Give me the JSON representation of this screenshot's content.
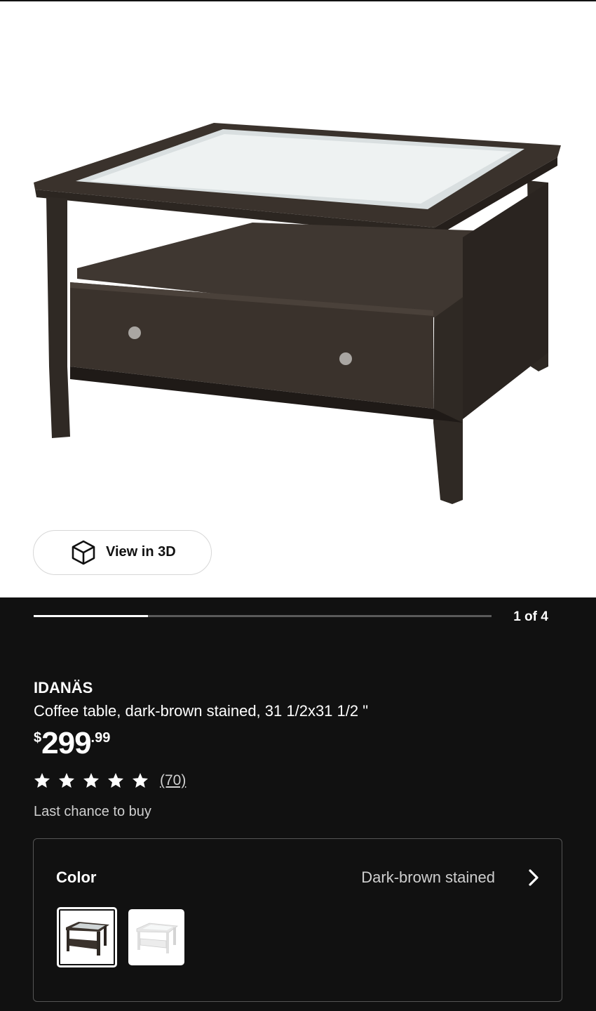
{
  "hero": {
    "view_3d_label": "View in 3D",
    "icons": {
      "view_3d": "cube-icon"
    }
  },
  "carousel": {
    "counter": "1 of 4",
    "progress": 0.25
  },
  "product": {
    "brand": "IDANÄS",
    "description": "Coffee table, dark-brown stained, 31 1/2x31 1/2 \"",
    "price": {
      "currency": "$",
      "integer": "299",
      "decimal": ".99"
    },
    "rating": {
      "stars": 5,
      "reviews": "(70)"
    },
    "availability": "Last chance to buy"
  },
  "color_selector": {
    "label": "Color",
    "value": "Dark-brown stained",
    "options": [
      "dark-brown",
      "white"
    ],
    "selected_index": 0,
    "icons": {
      "next": "chevron-right-icon"
    }
  },
  "colors": {
    "panel_bg": "#111111",
    "table_dark": "#3a322c",
    "table_white": "#f2f2f2"
  }
}
